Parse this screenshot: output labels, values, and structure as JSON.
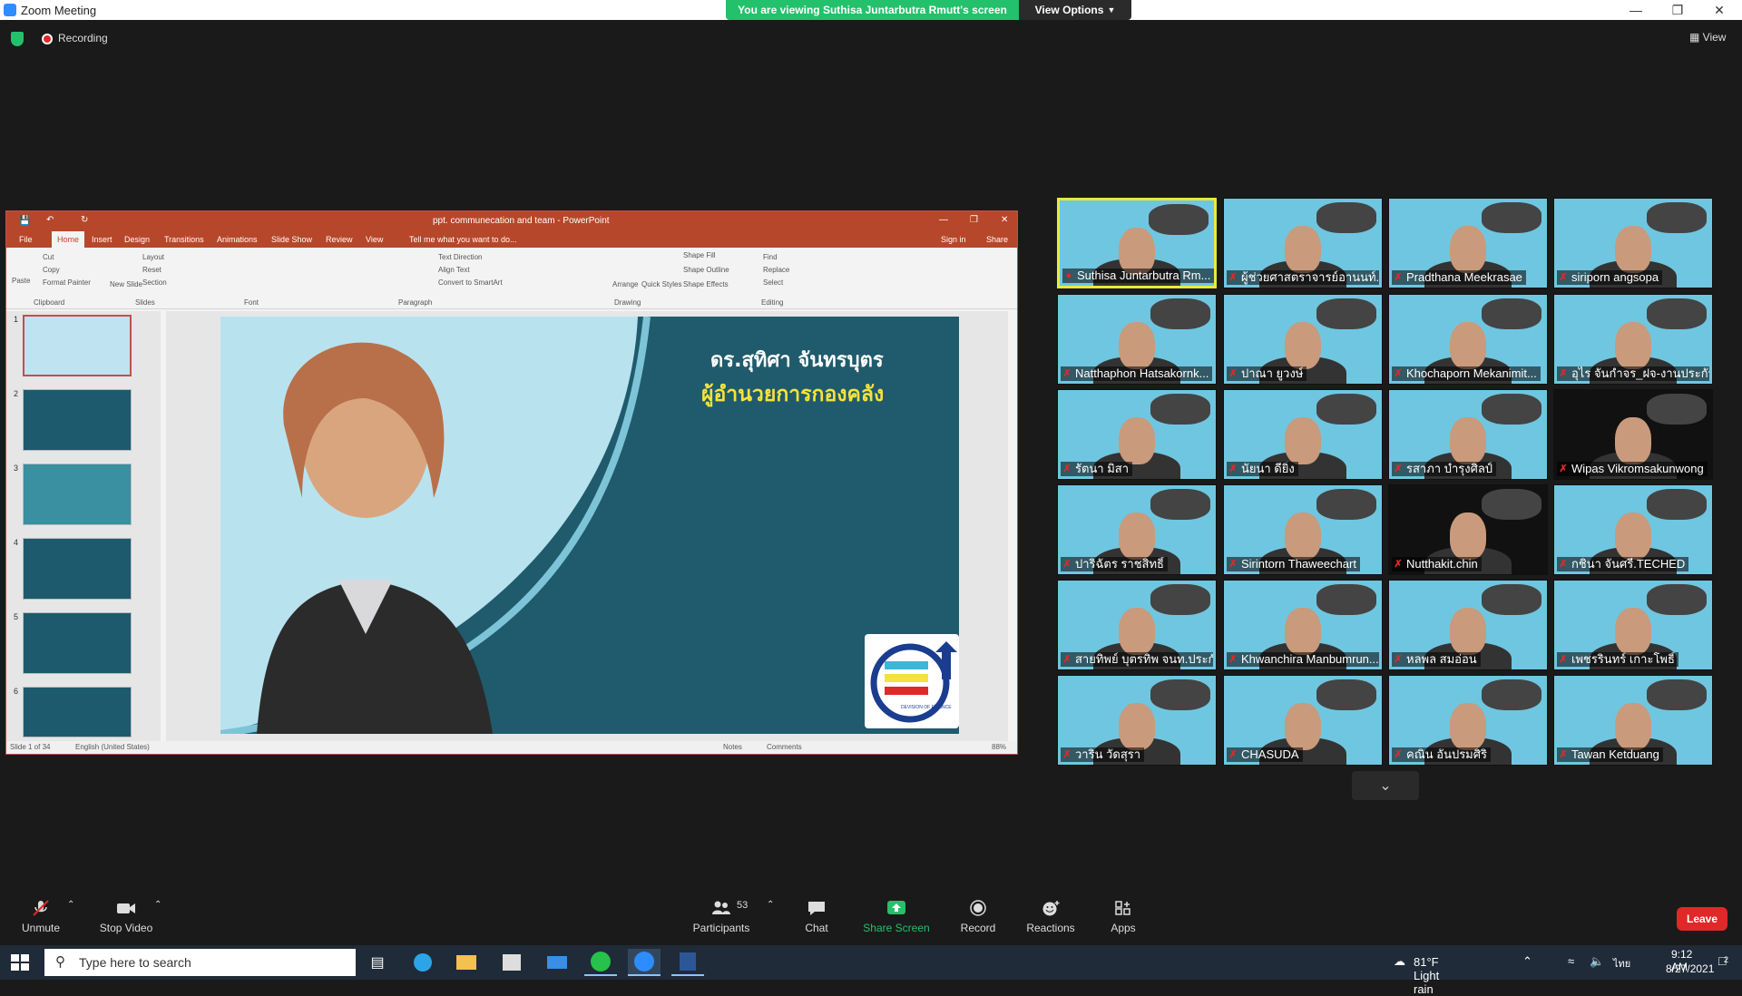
{
  "window": {
    "title": "Zoom Meeting"
  },
  "banner": {
    "viewing": "You are viewing Suthisa  Juntarbutra Rmutt's screen",
    "view_options": "View Options"
  },
  "status": {
    "recording": "Recording",
    "view": "View"
  },
  "ppt": {
    "title": "ppt. communecation and team - PowerPoint",
    "tabs": [
      "File",
      "Home",
      "Insert",
      "Design",
      "Transitions",
      "Animations",
      "Slide Show",
      "Review",
      "View"
    ],
    "tell_me": "Tell me what you want to do...",
    "sign_in": "Sign in",
    "share": "Share",
    "ribbon": {
      "paste": "Paste",
      "cut": "Cut",
      "copy": "Copy",
      "format_painter": "Format Painter",
      "clipboard": "Clipboard",
      "new_slide": "New Slide",
      "layout": "Layout",
      "reset": "Reset",
      "section": "Section",
      "slides": "Slides",
      "font": "Font",
      "paragraph": "Paragraph",
      "text_direction": "Text Direction",
      "align_text": "Align Text",
      "convert_smartart": "Convert to SmartArt",
      "arrange": "Arrange",
      "quick_styles": "Quick Styles",
      "shape_fill": "Shape Fill",
      "shape_outline": "Shape Outline",
      "shape_effects": "Shape Effects",
      "drawing": "Drawing",
      "find": "Find",
      "replace": "Replace",
      "select": "Select",
      "editing": "Editing"
    },
    "thumbnails": [
      "1",
      "2",
      "3",
      "4",
      "5",
      "6"
    ],
    "slide": {
      "name": "ดร.สุทิศา จันทรบุตร",
      "position": "ผู้อำนวยการกองคลัง",
      "logo_text": "DEVISION OF FINANCE"
    },
    "status_bar": {
      "slide_of": "Slide 1 of 34",
      "language": "English (United States)",
      "notes": "Notes",
      "comments": "Comments",
      "zoom": "88%"
    }
  },
  "participants": [
    {
      "name": "Suthisa  Juntarbutra Rm...",
      "active": true
    },
    {
      "name": "ผู้ช่วยศาสตราจารย์อานนท์..."
    },
    {
      "name": "Pradthana Meekrasae"
    },
    {
      "name": "siriporn angsopa"
    },
    {
      "name": "Natthaphon Hatsakornk..."
    },
    {
      "name": "ปาณา ยูวงษ์"
    },
    {
      "name": "Khochaporn Mekanimit..."
    },
    {
      "name": "อุไร จันกำจร_ฝจ-งานประกันคุ..."
    },
    {
      "name": "รัตนา มิสา"
    },
    {
      "name": "นัยนา ดียิ่ง"
    },
    {
      "name": "รสาภา บำรุงศิลป์"
    },
    {
      "name": "Wipas Vikromsakunwong"
    },
    {
      "name": "ปาริฉัตร ราชสิทธิ์"
    },
    {
      "name": "Sirintorn Thaweechart"
    },
    {
      "name": "Nutthakit.chin"
    },
    {
      "name": "กชินา จันศรี.TECHED"
    },
    {
      "name": "สายทิพย์ บุตรทิพ จนท.ประกั..."
    },
    {
      "name": "Khwanchira Manbumrun..."
    },
    {
      "name": "หลพล สมอ่อน"
    },
    {
      "name": "เพชรรินทร์ เกาะโพธิ์"
    },
    {
      "name": "วาริน วัดสุรา"
    },
    {
      "name": "CHASUDA"
    },
    {
      "name": "คณิน อันปรมศิริ"
    },
    {
      "name": "Tawan Ketduang"
    }
  ],
  "toolbar": {
    "unmute": "Unmute",
    "stop_video": "Stop Video",
    "participants": "Participants",
    "participant_count": "53",
    "chat": "Chat",
    "share_screen": "Share Screen",
    "record": "Record",
    "reactions": "Reactions",
    "apps": "Apps",
    "leave": "Leave"
  },
  "taskbar": {
    "search_placeholder": "Type here to search",
    "weather": "81°F  Light rain",
    "time": "9:12 AM",
    "date": "8/27/2021",
    "notifications": "2"
  },
  "colors": {
    "zoom_blue": "#2d8cff",
    "green": "#23c16b",
    "leave_red": "#e02828",
    "ppt_red": "#b7472a",
    "slide_teal": "#1f5b6c",
    "slide_accent": "#f5e23c"
  }
}
